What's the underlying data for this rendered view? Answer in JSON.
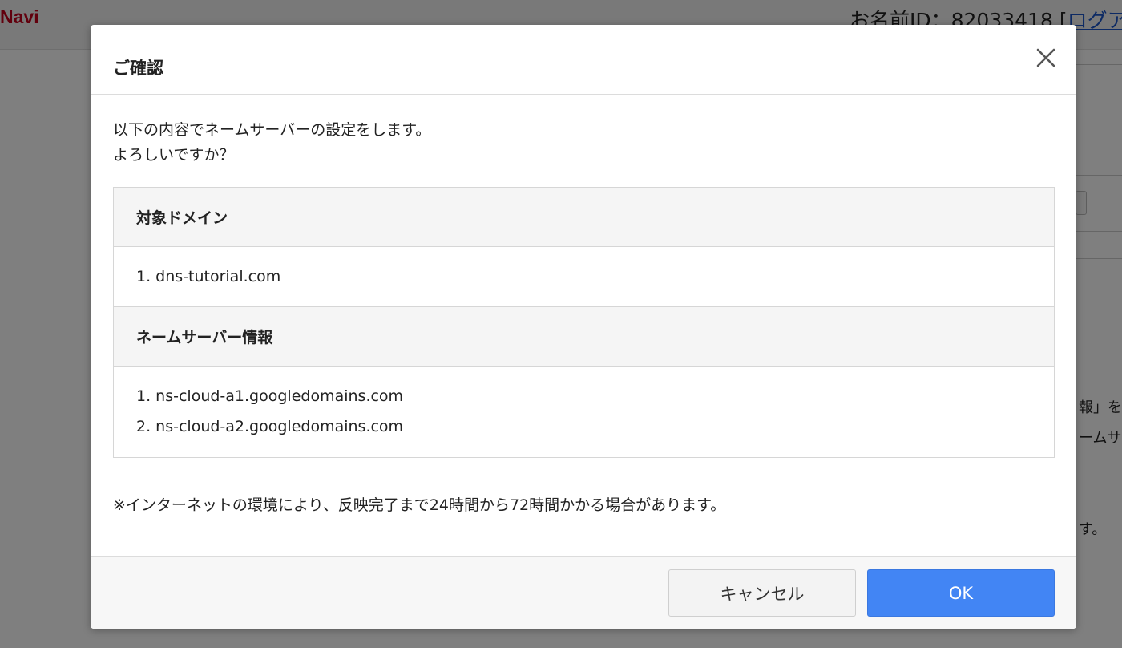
{
  "background": {
    "logo": "Navi",
    "account_prefix": "お名前ID：82033418 [",
    "logout_link": "ログアウ",
    "side_text_1": "報」を",
    "side_text_2": "ームサ",
    "side_text_3": "す。"
  },
  "modal": {
    "title": "ご確認",
    "close_icon": "close-icon",
    "message_line1": "以下の内容でネームサーバーの設定をします。",
    "message_line2": "よろしいですか？",
    "domain_header": "対象ドメイン",
    "domains": [
      "1. dns-tutorial.com"
    ],
    "nameserver_header": "ネームサーバー情報",
    "nameservers": [
      "1. ns-cloud-a1.googledomains.com",
      "2. ns-cloud-a2.googledomains.com"
    ],
    "note": "※インターネットの環境により、反映完了まで24時間から72時間かかる場合があります。",
    "cancel_label": "キャンセル",
    "ok_label": "OK"
  },
  "colors": {
    "ok_button": "#4285f4",
    "logo": "#c4001a"
  }
}
